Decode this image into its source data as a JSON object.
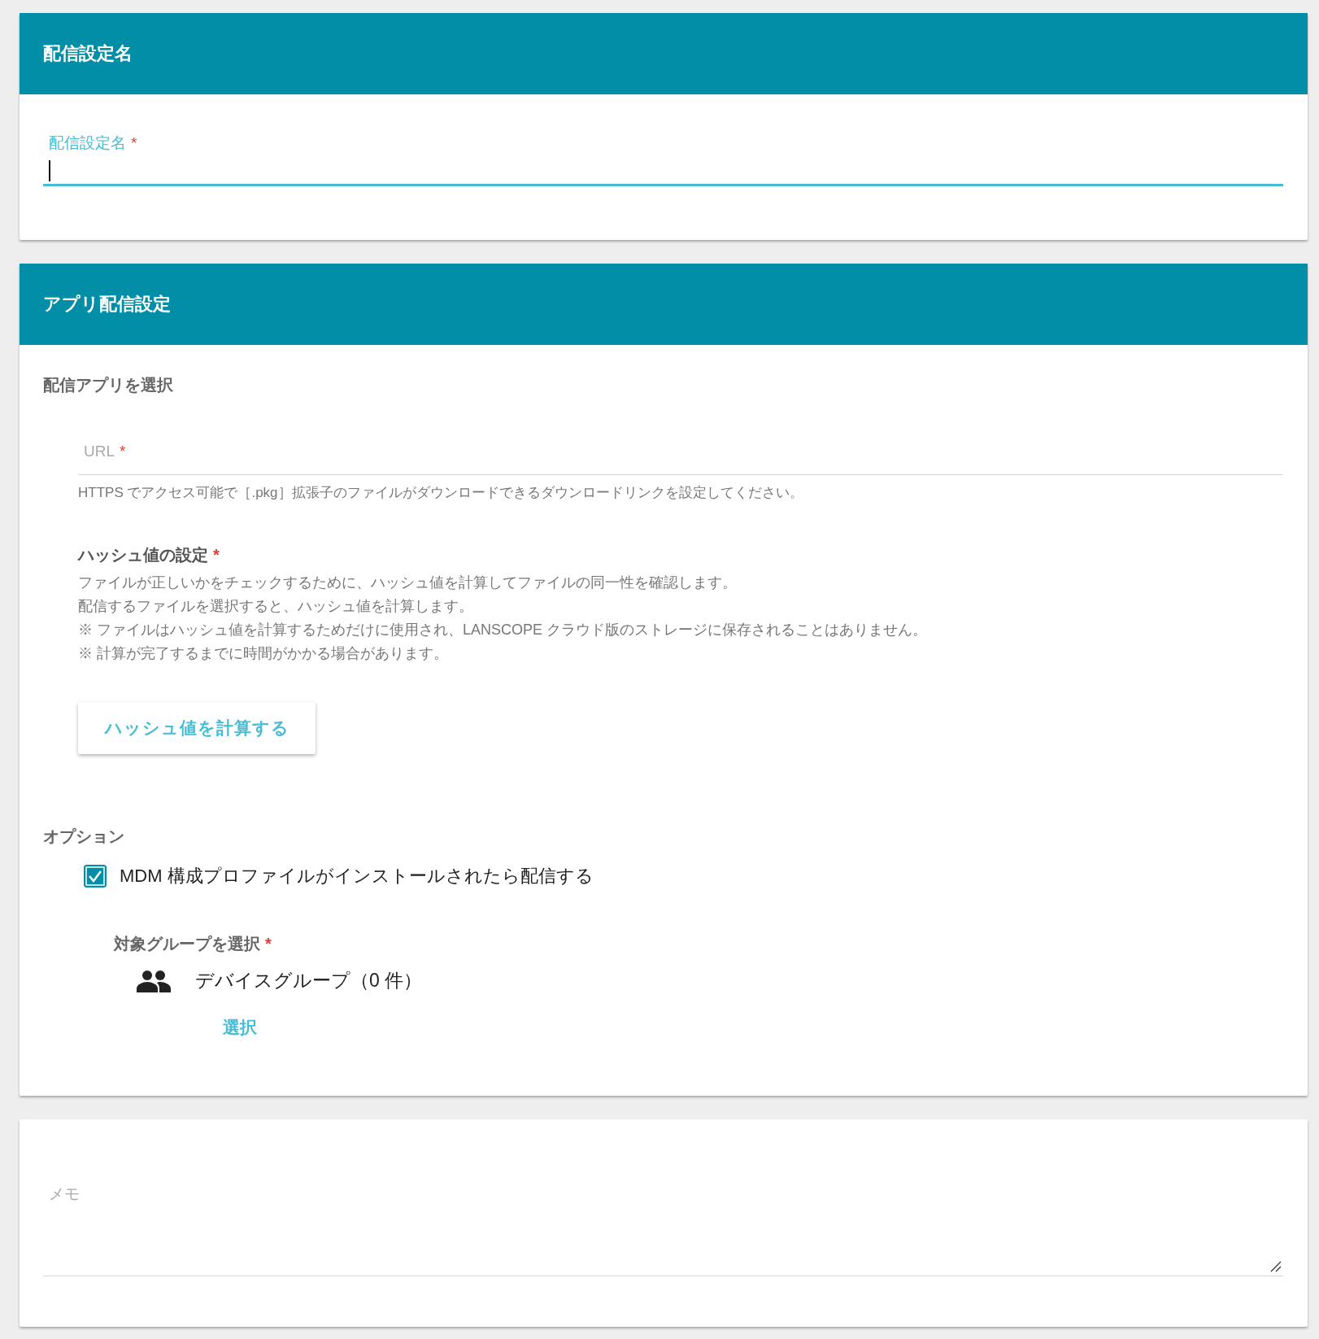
{
  "name_section": {
    "title": "配信設定名",
    "field": {
      "label": "配信設定名",
      "required_mark": "*",
      "focused": true
    }
  },
  "app_section": {
    "title": "アプリ配信設定",
    "subheading": "配信アプリを選択",
    "url_field": {
      "label": "URL",
      "required_mark": "*",
      "focused": false,
      "helper": "HTTPS でアクセス可能で［.pkg］拡張子のファイルがダウンロードできるダウンロードリンクを設定してください。"
    },
    "hash": {
      "title": "ハッシュ値の設定",
      "required_mark": "*",
      "lines": [
        "ファイルが正しいかをチェックするために、ハッシュ値を計算してファイルの同一性を確認します。",
        "配信するファイルを選択すると、ハッシュ値を計算します。",
        "※ ファイルはハッシュ値を計算するためだけに使用され、LANSCOPE クラウド版のストレージに保存されることはありません。",
        "※ 計算が完了するまでに時間がかかる場合があります。"
      ],
      "button": "ハッシュ値を計算する"
    },
    "options": {
      "title": "オプション",
      "checkbox": {
        "label": "MDM 構成プロファイルがインストールされたら配信する",
        "checked": true
      }
    },
    "group": {
      "label": "対象グループを選択",
      "required_mark": "*",
      "item": "デバイスグループ（0 件）",
      "link": "選択"
    }
  },
  "memo": {
    "label": "メモ"
  }
}
